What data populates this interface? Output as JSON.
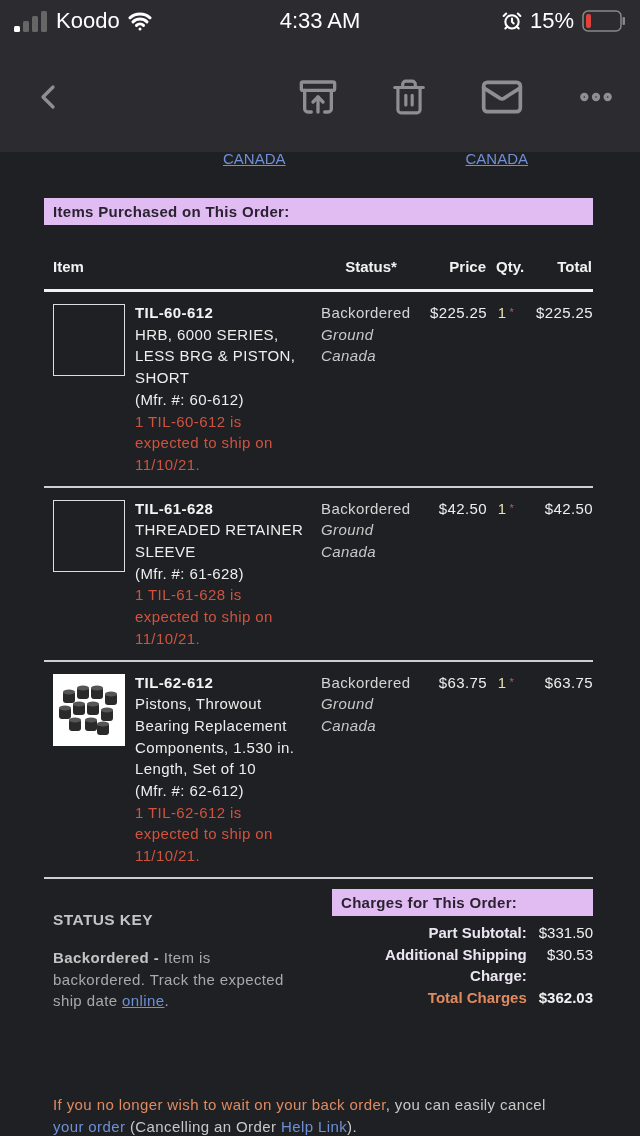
{
  "status_bar": {
    "carrier": "Koodo",
    "time": "4:33 AM",
    "battery": "15%"
  },
  "address_links": [
    "CANADA",
    "CANADA"
  ],
  "items_heading": "Items Purchased on This Order:",
  "columns": [
    "Item",
    "Status*",
    "Price",
    "Qty.",
    "Total"
  ],
  "items": [
    {
      "kind": "empty",
      "sku": "TIL-60-612",
      "description": "HRB, 6000 SERIES, LESS BRG & PISTON, SHORT",
      "mfr": "(Mfr. #: 60-612)",
      "note": "1 TIL-60-612 is expected to ship on 11/10/21.",
      "status": "Backordered",
      "shipping": "Ground",
      "destination": "Canada",
      "price": "$225.25",
      "qty": "1",
      "qty_mark": "*",
      "total": "$225.25"
    },
    {
      "kind": "empty",
      "sku": "TIL-61-628",
      "description": "THREADED RETAINER SLEEVE",
      "mfr": "(Mfr. #: 61-628)",
      "note": "1 TIL-61-628 is expected to ship on 11/10/21.",
      "status": "Backordered",
      "shipping": "Ground",
      "destination": "Canada",
      "price": "$42.50",
      "qty": "1",
      "qty_mark": "*",
      "total": "$42.50"
    },
    {
      "kind": "photo",
      "sku": "TIL-62-612",
      "description": "Pistons, Throwout Bearing Replacement Components, 1.530 in. Length, Set of 10",
      "mfr": "(Mfr. #: 62-612)",
      "note": "1 TIL-62-612 is expected to ship on 11/10/21.",
      "status": "Backordered",
      "shipping": "Ground",
      "destination": "Canada",
      "price": "$63.75",
      "qty": "1",
      "qty_mark": "*",
      "total": "$63.75"
    }
  ],
  "status_key": {
    "title": "STATUS KEY",
    "text": "**Backordered -** Item is backordered. Track the expected ship date ",
    "link": "online",
    "end": "."
  },
  "charges": {
    "heading": "Charges for This Order:",
    "rows": [
      {
        "kind": "normal",
        "label": "Part Subtotal:",
        "value": "$331.50"
      },
      {
        "kind": "normal",
        "label": "Additional Shipping Charge:",
        "value": "$30.53"
      },
      {
        "kind": "total",
        "label": "Total Charges",
        "value": "$362.03"
      }
    ]
  },
  "footer": [
    {
      "kind": "accent",
      "text": "If you no longer wish to wait on your back order"
    },
    {
      "kind": "plain",
      "text": ", you can easily cancel "
    },
    {
      "kind": "link",
      "text": "your order"
    },
    {
      "kind": "plain",
      "text": " (Cancelling an Order "
    },
    {
      "kind": "link",
      "text": "Help Link"
    },
    {
      "kind": "plain",
      "text": ")."
    }
  ]
}
